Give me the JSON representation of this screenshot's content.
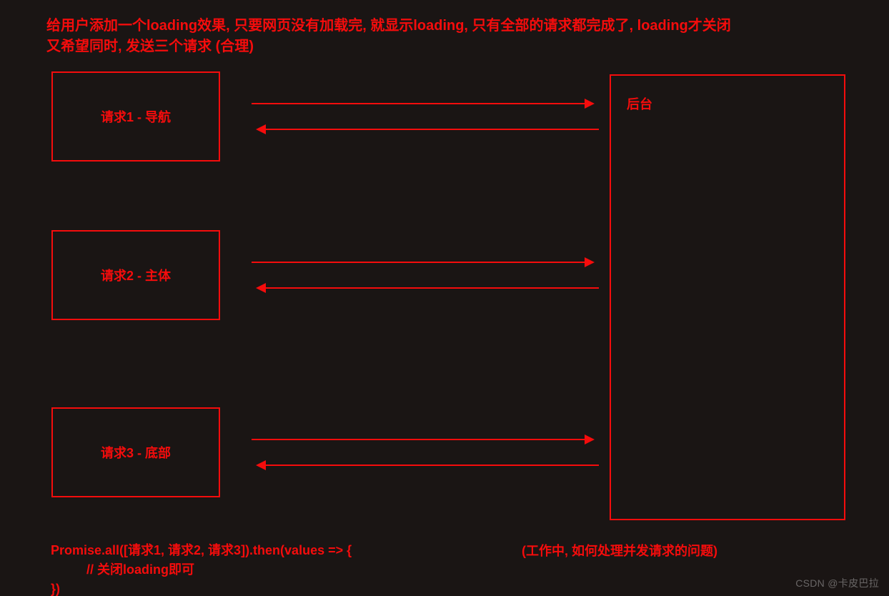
{
  "title_line1": "给用户添加一个loading效果, 只要网页没有加载完, 就显示loading, 只有全部的请求都完成了, loading才关闭",
  "title_line2": "又希望同时, 发送三个请求 (合理)",
  "requests": {
    "r1": "请求1 - 导航",
    "r2": "请求2 - 主体",
    "r3": "请求3 - 底部"
  },
  "backend_label": "后台",
  "code": {
    "l1": "Promise.all([请求1, 请求2, 请求3]).then(values => {",
    "l2": "          // 关闭loading即可",
    "l3": "})"
  },
  "note": "(工作中, 如何处理并发请求的问题)",
  "watermark": "CSDN @卡皮巴拉"
}
